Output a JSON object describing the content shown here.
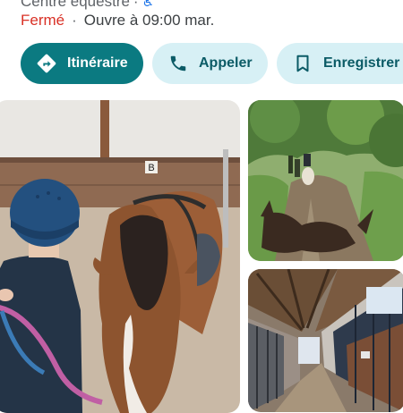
{
  "place": {
    "category": "Centre équestre",
    "accessibility_icon": "wheelchair-icon",
    "status": "Fermé",
    "separator": "·",
    "hours": "Ouvre à 09:00 mar."
  },
  "actions": {
    "directions": {
      "label": "Itinéraire",
      "icon": "directions-icon"
    },
    "call": {
      "label": "Appeler",
      "icon": "phone-icon"
    },
    "save": {
      "label": "Enregistrer",
      "icon": "bookmark-icon"
    }
  },
  "photos": [
    {
      "name": "photo-child-and-horse",
      "letter_on_wall": "B"
    },
    {
      "name": "photo-riding-path"
    },
    {
      "name": "photo-stable-aisle"
    }
  ],
  "colors": {
    "primary": "#0b7a81",
    "secondary_chip": "#d7f0f5",
    "closed": "#d93025",
    "text_muted": "#5f6368"
  }
}
